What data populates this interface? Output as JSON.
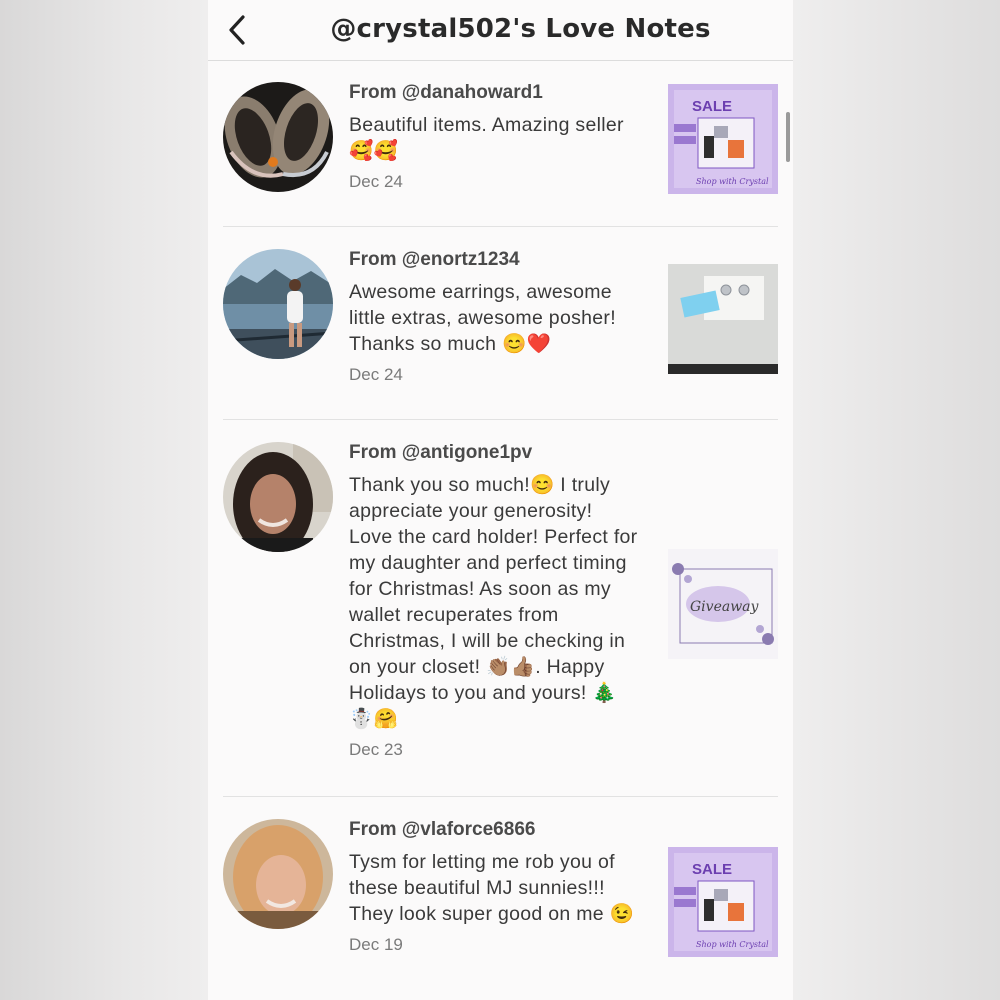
{
  "header": {
    "title": "@crystal502's Love Notes"
  },
  "notes": [
    {
      "from_prefix": "From ",
      "handle": "@danahoward1",
      "message": "Beautiful items. Amazing seller 🥰🥰",
      "date": "Dec 24",
      "thumb": {
        "line1": "SALE",
        "signature": "Shop with Crystal"
      }
    },
    {
      "from_prefix": "From ",
      "handle": "@enortz1234",
      "message": "Awesome earrings, awesome little extras, awesome posher! Thanks so much 😊❤️",
      "date": "Dec 24"
    },
    {
      "from_prefix": "From ",
      "handle": "@antigone1pv",
      "message": "Thank you so much!😊 I truly appreciate your generosity! Love the card holder! Perfect for my daughter and perfect timing for Christmas! As soon as my wallet recuperates from Christmas, I will be checking in on your closet! 👏🏽👍🏽. Happy Holidays to you and yours! 🎄☃️🤗",
      "date": "Dec 23",
      "thumb": {
        "label": "Giveaway"
      }
    },
    {
      "from_prefix": "From ",
      "handle": "@vlaforce6866",
      "message": "Tysm for letting me rob you of these beautiful MJ sunnies!!! They look super good on me 😉",
      "date": "Dec 19",
      "thumb": {
        "line1": "SALE",
        "signature": "Shop with Crystal"
      }
    }
  ]
}
